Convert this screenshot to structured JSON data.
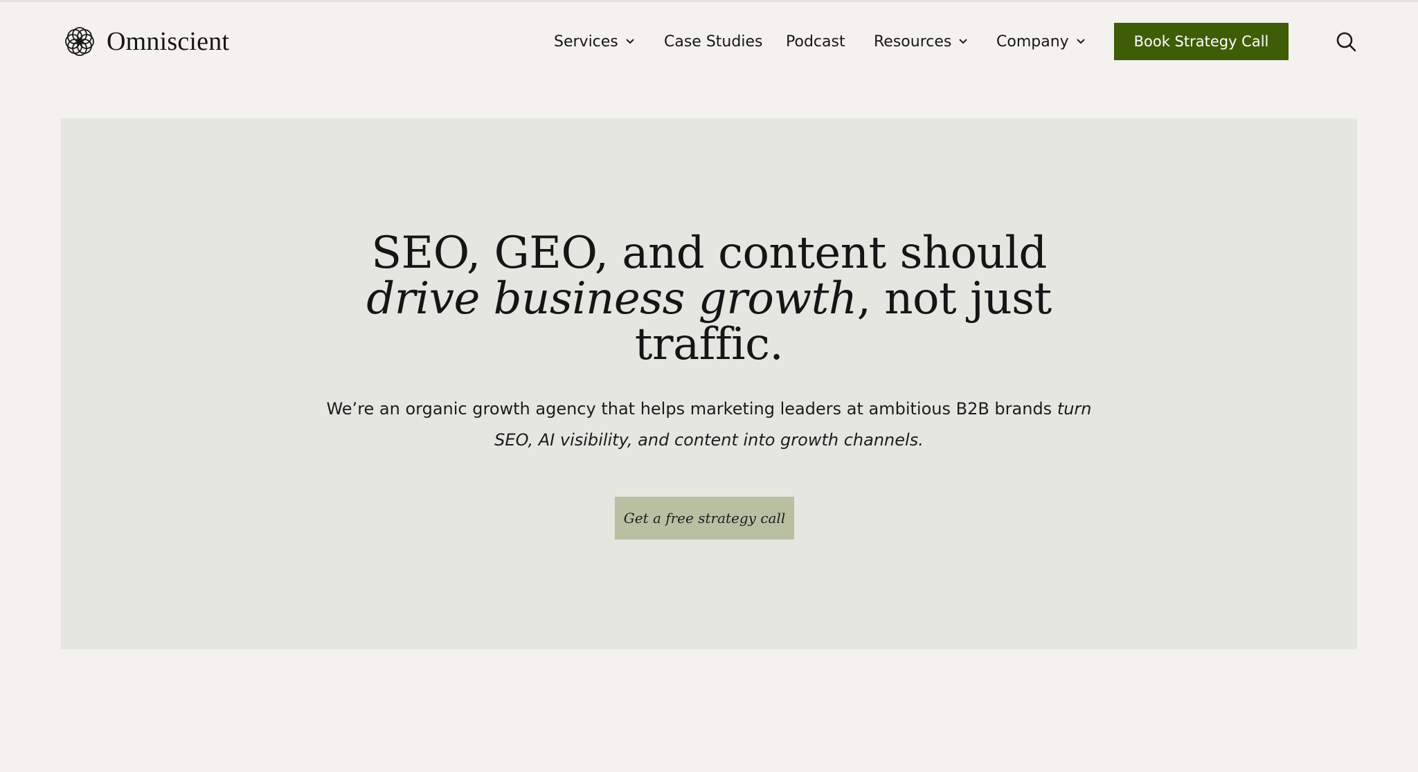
{
  "brand": {
    "name": "Omniscient",
    "logo_icon": "interlocking-circles-logo"
  },
  "nav": {
    "items": [
      {
        "label": "Services",
        "has_dropdown": true
      },
      {
        "label": "Case Studies",
        "has_dropdown": false
      },
      {
        "label": "Podcast",
        "has_dropdown": false
      },
      {
        "label": "Resources",
        "has_dropdown": true
      },
      {
        "label": "Company",
        "has_dropdown": true
      }
    ],
    "cta_label": "Book Strategy Call",
    "search_icon": "search-icon"
  },
  "hero": {
    "title_line1": "SEO, GEO, and content should",
    "title_line2_em": "drive business growth",
    "title_line2_rest": ", not just",
    "title_line3": "traffic.",
    "subtitle_line1_plain": "We’re an organic growth agency that helps marketing leaders at ambitious B2B brands ",
    "subtitle_line1_em": "turn",
    "subtitle_line2_em": "SEO, AI visibility, and content into growth channels.",
    "cta_label": "Get a free strategy call"
  },
  "colors": {
    "page_background": "#f3f2ef",
    "hero_background": "#e5e6e0",
    "primary_cta": "#3f5d07",
    "secondary_cta": "#b9c0a2",
    "text": "#161616"
  }
}
